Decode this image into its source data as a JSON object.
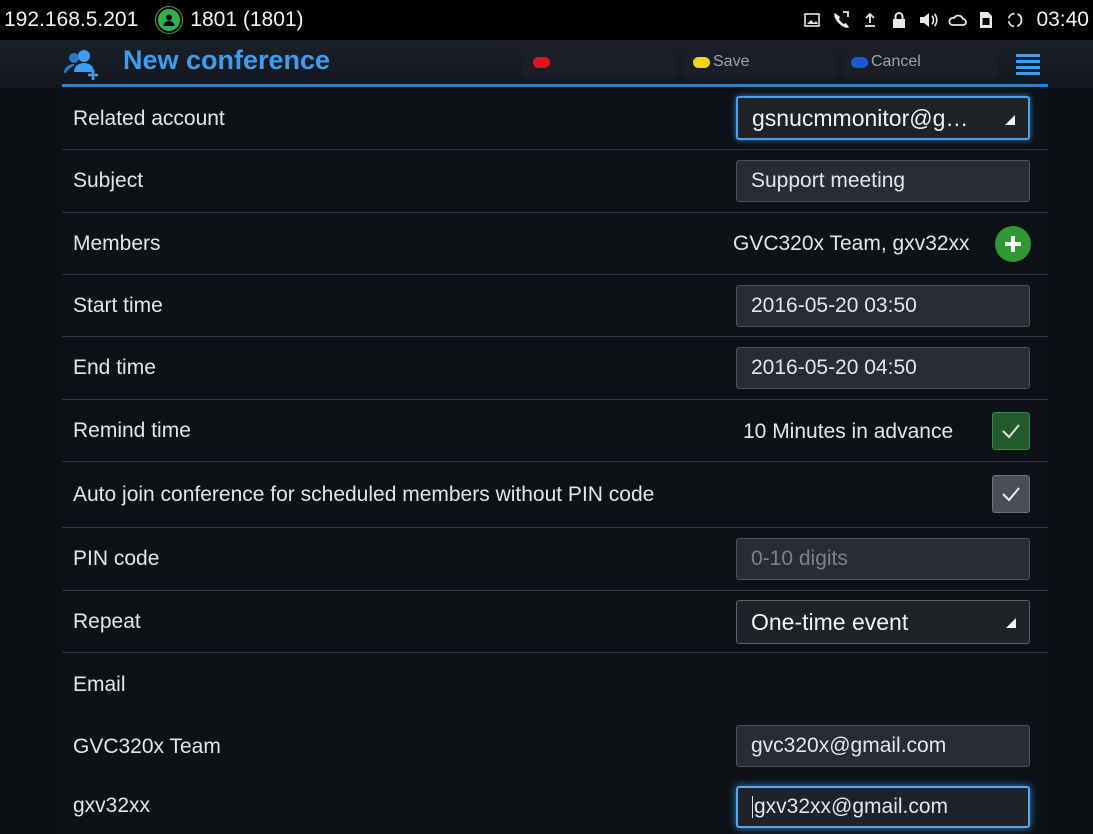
{
  "status_bar": {
    "ip": "192.168.5.201",
    "account": "1801 (1801)",
    "time": "03:40",
    "icons": [
      "image-icon",
      "call-forward-icon",
      "upload-icon",
      "lock-icon",
      "volume-icon",
      "cloud-icon",
      "sim-icon",
      "sync-icon"
    ]
  },
  "action_bar": {
    "title": "New conference",
    "softkeys": {
      "red_label": "",
      "save_label": "Save",
      "cancel_label": "Cancel"
    },
    "colors": {
      "accent": "#3d9df2",
      "red": "#e0141c",
      "yellow": "#f2d21a",
      "blue": "#1b58d6"
    }
  },
  "form": {
    "related_account": {
      "label": "Related account",
      "value": "gsnucmmonitor@g…"
    },
    "subject": {
      "label": "Subject",
      "value": "Support meeting"
    },
    "members": {
      "label": "Members",
      "value": "GVC320x Team, gxv32xx"
    },
    "start_time": {
      "label": "Start time",
      "value": "2016-05-20 03:50"
    },
    "end_time": {
      "label": "End time",
      "value": "2016-05-20 04:50"
    },
    "remind_time": {
      "label": "Remind time",
      "value": "10 Minutes in advance",
      "checked": true
    },
    "auto_join": {
      "label": "Auto join conference for scheduled members without PIN code",
      "checked": true
    },
    "pin_code": {
      "label": "PIN code",
      "value": "",
      "placeholder": "0-10 digits"
    },
    "repeat": {
      "label": "Repeat",
      "value": "One-time event"
    },
    "email": {
      "label": "Email",
      "entries": [
        {
          "name": "GVC320x Team",
          "value": "gvc320x@gmail.com"
        },
        {
          "name": "gxv32xx",
          "value": "gxv32xx@gmail.com"
        }
      ]
    }
  }
}
